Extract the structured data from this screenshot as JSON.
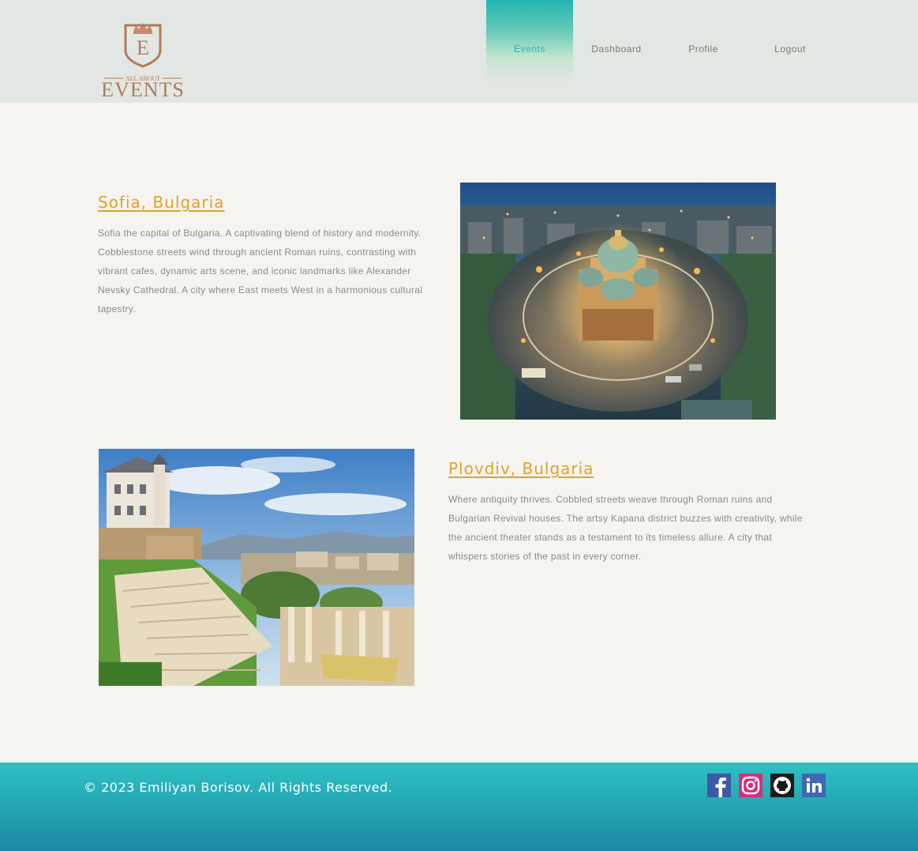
{
  "header": {
    "logo": {
      "top_text": "ALL ABOUT",
      "main_text": "EVENTS",
      "letter": "E"
    },
    "nav": [
      {
        "label": "Events",
        "active": true
      },
      {
        "label": "Dashboard",
        "active": false
      },
      {
        "label": "Profile",
        "active": false
      },
      {
        "label": "Logout",
        "active": false
      }
    ]
  },
  "destinations": [
    {
      "title": "Sofia, Bulgaria",
      "description": "Sofia the capital of Bulgaria. A captivating blend of history and modernity. Cobblestone streets wind through ancient Roman ruins, contrasting with vibrant cafes, dynamic arts scene, and iconic landmarks like Alexander Nevsky Cathedral. A city where East meets West in a harmonious cultural tapestry."
    },
    {
      "title": "Plovdiv, Bulgaria",
      "description": "Where antiquity thrives. Cobbled streets weave through Roman ruins and Bulgarian Revival houses. The artsy Kapana district buzzes with creativity, while the ancient theater stands as a testament to its timeless allure. A city that whispers stories of the past in every corner."
    }
  ],
  "footer": {
    "copyright": "© 2023 Emiliyan Borisov. All Rights Reserved.",
    "socials": [
      "facebook-icon",
      "instagram-icon",
      "github-icon",
      "linkedin-icon"
    ]
  },
  "colors": {
    "accent_teal": "#2ab0b3",
    "title_gold": "#e0a229",
    "logo_bronze": "#b07a5a"
  }
}
